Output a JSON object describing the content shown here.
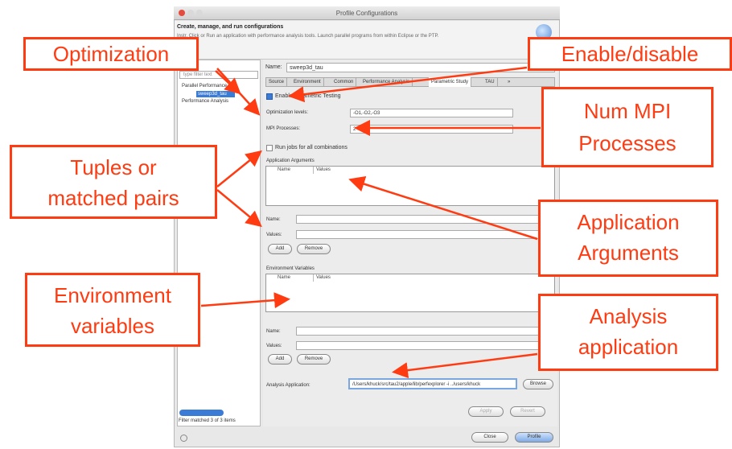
{
  "window": {
    "title": "Profile Configurations",
    "header_title": "Create, manage, and run configurations",
    "header_desc": "Instr. Click or Run an application with performance analysis tools.  Launch parallel programs from within Eclipse or the PTP."
  },
  "left_panel": {
    "filter_placeholder": "type filter text",
    "tree": [
      "Parallel Performance",
      "sweep3d_tau",
      "Performance Analysis"
    ],
    "status": "Filter matched 3 of 3 items"
  },
  "config": {
    "name_label": "Name:",
    "name_value": "sweep3d_tau",
    "tabs": [
      "Source",
      "Environment",
      "Common",
      "Performance Analysis",
      "Parametric Study",
      "TAU",
      "»"
    ],
    "enable_label": "Enable Parametric Testing",
    "optimization_label": "Optimization levels:",
    "optimization_value": "-O1,-O2,-O3",
    "mpi_label": "MPI Processes:",
    "mpi_value": "2",
    "combinations_label": "Run jobs for all combinations",
    "app_args_group": "Application Arguments",
    "env_vars_group": "Environment Variables",
    "col_name": "Name",
    "col_values": "Values",
    "field_name": "Name:",
    "field_values": "Values:",
    "add": "Add",
    "remove": "Remove",
    "analysis_label": "Analysis Application:",
    "analysis_value": "/Users/khuck/src/tau2/apple/lib/perfexplorer -i ../users/khuck",
    "browse": "Browse",
    "apply": "Apply",
    "revert": "Revert",
    "close": "Close",
    "profile": "Profile"
  },
  "annotations": {
    "optimization": "Optimization",
    "enable": "Enable/disable",
    "num_mpi_1": "Num MPI",
    "num_mpi_2": "Processes",
    "tuples_1": "Tuples or",
    "tuples_2": "matched pairs",
    "app_args_1": "Application",
    "app_args_2": "Arguments",
    "env_1": "Environment",
    "env_2": "variables",
    "analysis_1": "Analysis",
    "analysis_2": "application"
  },
  "colors": {
    "annotation": "#ff3b12",
    "selection": "#3a7bd5"
  }
}
